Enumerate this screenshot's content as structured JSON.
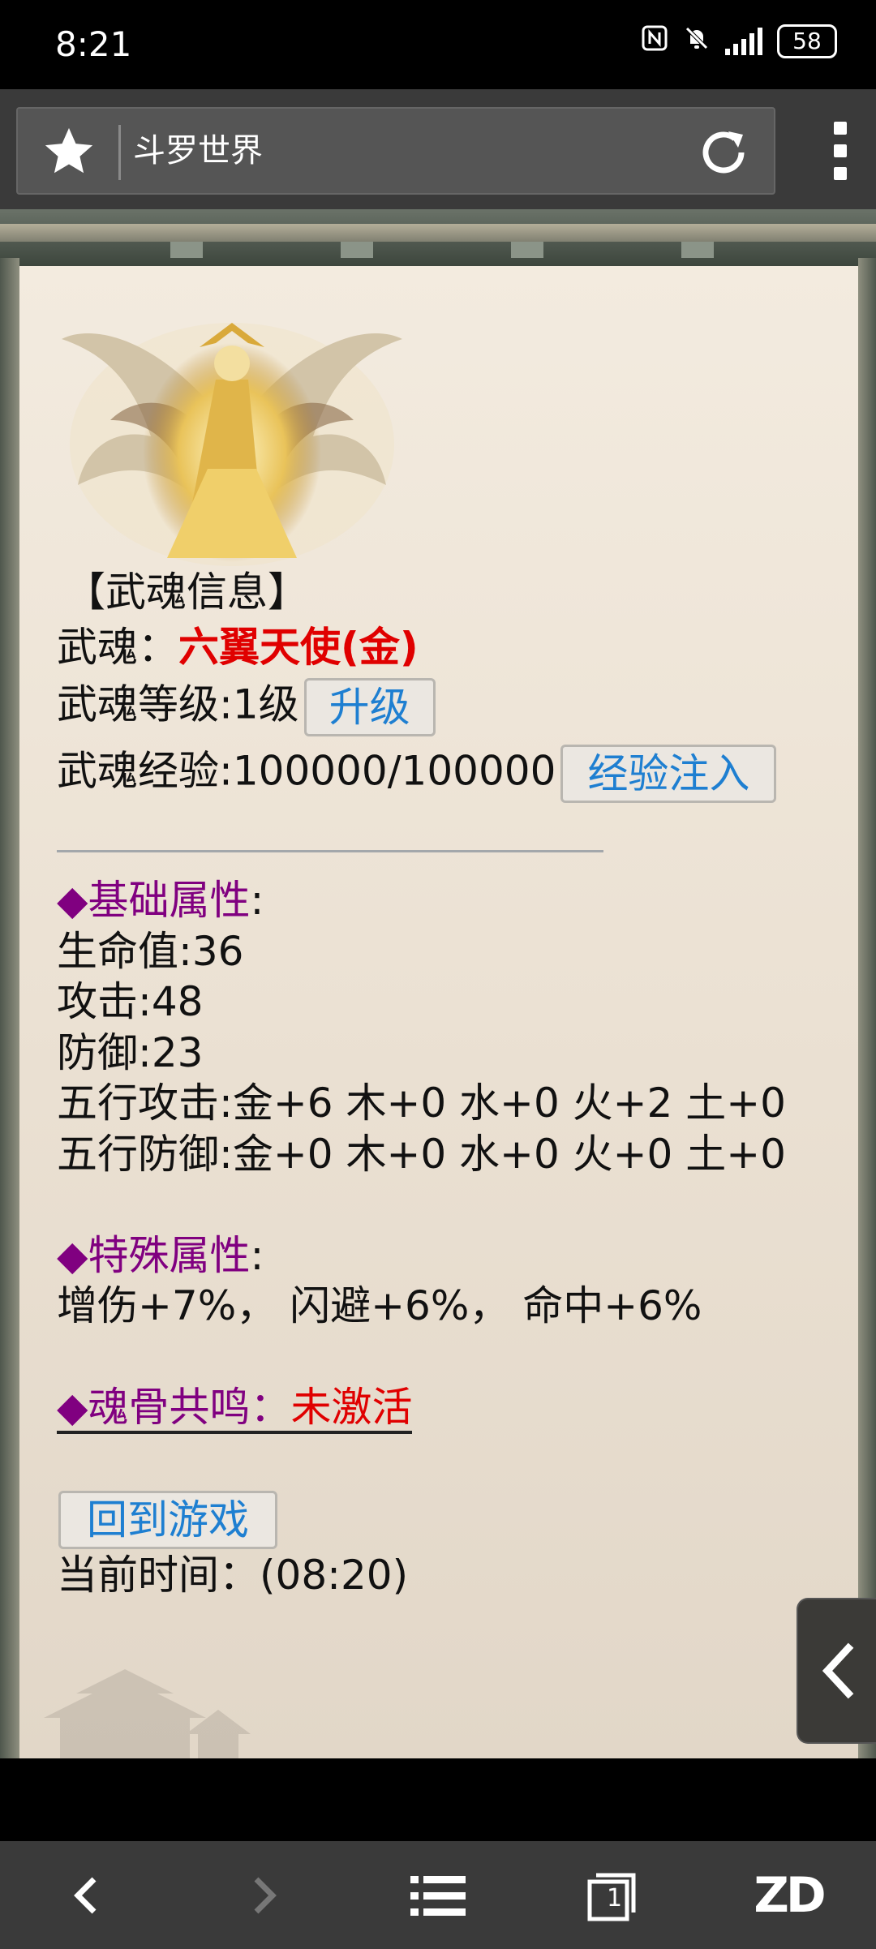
{
  "status_bar": {
    "time": "8:21",
    "battery": "58"
  },
  "browser": {
    "page_title": "斗罗世界"
  },
  "wuhun": {
    "section_title": "【武魂信息】",
    "name_label": "武魂：",
    "name_value": "六翼天使(金)",
    "level_label": "武魂等级:1级",
    "upgrade_button": "升级",
    "exp_label": "武魂经验:100000/100000",
    "exp_inject_button": "经验注入"
  },
  "basic_attrs": {
    "heading": "◆基础属性",
    "colon": ":",
    "hp": "生命值:36",
    "attack": "攻击:48",
    "defense": "防御:23",
    "element_attack": "五行攻击:金+6 木+0 水+0 火+2 土+0",
    "element_defense": "五行防御:金+0 木+0 水+0 火+0 土+0"
  },
  "special_attrs": {
    "heading": "◆特殊属性",
    "colon": ":",
    "values": "增伤+7%， 闪避+6%， 命中+6%"
  },
  "soul_bone": {
    "heading": "◆魂骨共鸣：",
    "status": "未激活"
  },
  "footer": {
    "back_to_game_button": "回到游戏",
    "current_time": "当前时间：(08:20)"
  },
  "bottom_nav": {
    "tabs_count": "1",
    "brand": "ZD"
  }
}
